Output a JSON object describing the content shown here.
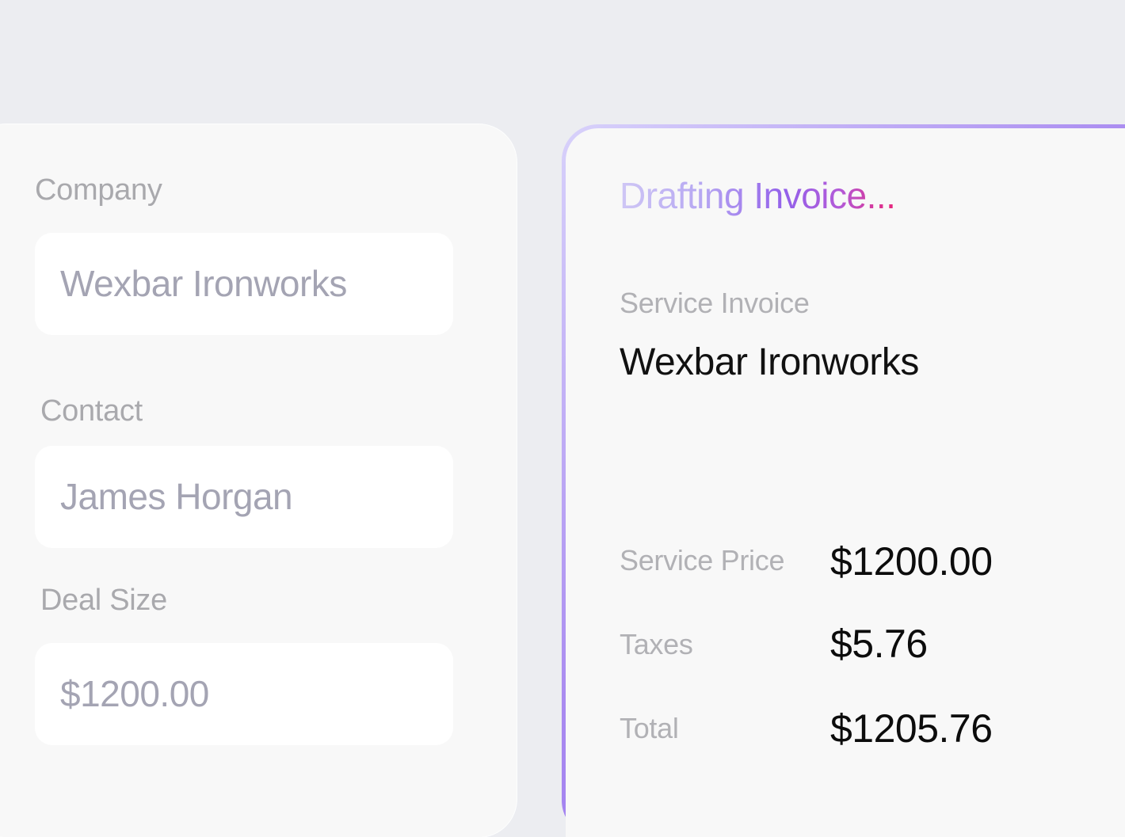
{
  "form": {
    "company": {
      "label": "Company",
      "value": "Wexbar Ironworks"
    },
    "contact": {
      "label": "Contact",
      "value": "James Horgan"
    },
    "deal_size": {
      "label": "Deal Size",
      "value": "$1200.00"
    }
  },
  "invoice": {
    "status_title": "Drafting Invoice...",
    "type": "Service Invoice",
    "company": "Wexbar Ironworks",
    "rows": [
      {
        "label": "Service Price",
        "value": "$1200.00"
      },
      {
        "label": "Taxes",
        "value": "$5.76"
      },
      {
        "label": "Total",
        "value": "$1205.76"
      }
    ]
  },
  "colors": {
    "background": "#ecedf1",
    "card": "#f8f8f8",
    "accent_purple": "#8a63ec",
    "accent_pink": "#e8247a"
  }
}
